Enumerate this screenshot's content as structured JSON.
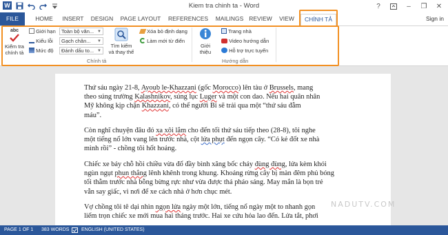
{
  "window": {
    "title": "Kiem tra chinh ta - Word",
    "min": "–",
    "max": "❐",
    "close": "✕",
    "help": "?"
  },
  "tabs": [
    "FILE",
    "HOME",
    "INSERT",
    "DESIGN",
    "PAGE LAYOUT",
    "REFERENCES",
    "MAILINGS",
    "REVIEW",
    "VIEW",
    "CHÍNH TẢ"
  ],
  "signin": "Sign in",
  "ribbon": {
    "spell_top": "abc",
    "spell_label_1": "Kiểm tra",
    "spell_label_2": "chính tả",
    "gioi_han": "Giới hạn",
    "kieu_loi": "Kiểu lỗi",
    "muc_do": "Mức độ",
    "dd1": "Toàn bộ văn...",
    "dd2": "Gạch chân...",
    "dd3": "Đánh dấu to...",
    "search_label_1": "Tìm kiếm",
    "search_label_2": "và thay thế",
    "xoa_bo": "Xóa bỏ định dạng",
    "lam_moi": "Làm mới từ điển",
    "gioi_thieu_1": "Giới",
    "gioi_thieu_2": "thiệu",
    "trang_nha": "Trang nhà",
    "video": "Video hướng dẫn",
    "ho_tro": "Hỗ trợ trực tuyến",
    "group1": "Chính tả",
    "group2": "Hướng dẫn"
  },
  "document": {
    "p1_l1a": "Thứ sáu ngày 21-8, ",
    "p1_l1b": "Ayoub le-Khazzani",
    "p1_l1c": " (gốc ",
    "p1_l1d": "Morocco",
    "p1_l1e": ") lên tàu ở ",
    "p1_l1f": "Brussels",
    "p1_l1g": ", mang",
    "p1_l2a": "theo súng trường ",
    "p1_l2b": "Kalashnikov",
    "p1_l2c": ", súng lục ",
    "p1_l2d": "Luger",
    "p1_l2e": " và một con dao. Nếu hai quân nhân",
    "p1_l3a": "Mỹ không kịp chặn ",
    "p1_l3b": "Khazzani",
    "p1_l3c": ", có thể người Bỉ sẽ trải qua một “thứ sáu đẫm",
    "p1_l4": "máu”.",
    "p2_l1a": "Còn nghĩ chuyện đâu đó ",
    "p2_l1b": "xa xôi lắm",
    "p2_l1c": " cho đến tối thứ sáu tiếp theo (28-8), tôi nghe",
    "p2_l2a": "một tiếng nổ lớn vang lên trước nhà, cột ",
    "p2_l2b": "lửa phụt",
    "p2_l2c": " đến ngọn cây. “Có kẻ đốt xe nhà",
    "p2_l3": "mình rồi” - chồng tôi hốt hoảng.",
    "p3_l1a": "Chiếc xe bảy chỗ hồi chiều vừa đổ đầy bình xăng bốc cháy ",
    "p3_l1b": "đùng đùng",
    "p3_l1c": ", lửa kèm khói",
    "p3_l2a": "ngùn ngụt ",
    "p3_l2b": "phun thẳng",
    "p3_l2c": " lênh khênh trong khung. Khoảng rừng cây bị màn đêm phủ bóng",
    "p3_l3": "tối thẫm trước nhà bỗng bừng rực như vừa được thả pháo sáng. May mắn là bọn trẻ",
    "p3_l4": "vẫn say giấc, vì nơi để xe cách nhà ở hơn chục mét.",
    "p4_l1a": "Vợ chồng tôi tê dại nhìn ",
    "p4_l1b": "ngọn lửa",
    "p4_l1c": " ngày một lớn, tiếng nổ ngày một to nhanh gọn",
    "p4_l2": "liếm trọn chiếc xe mới mua hai tháng trước. Hai xe cứu hỏa lao đến. Lửa tắt, phơi"
  },
  "watermark": "NADUTV.COM",
  "status": {
    "page": "PAGE 1 OF 1",
    "words": "383 WORDS",
    "lang": "ENGLISH (UNITED STATES)"
  },
  "colors": {
    "brand": "#2b579a",
    "highlight": "#f29022"
  }
}
